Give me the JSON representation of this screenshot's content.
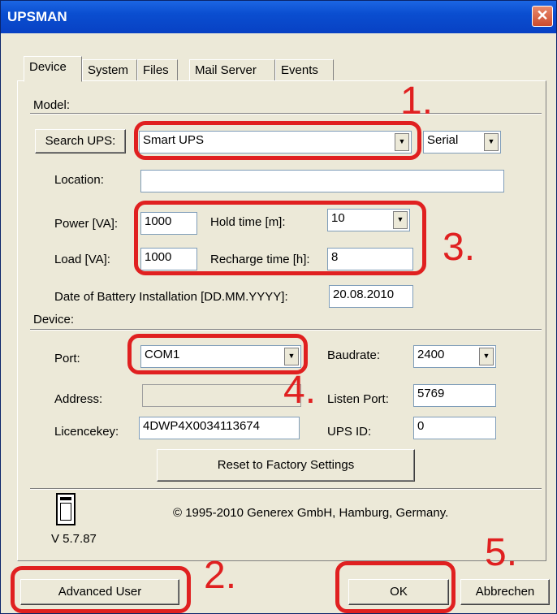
{
  "window": {
    "title": "UPSMAN",
    "close": "✕"
  },
  "tabs": [
    "Device",
    "System",
    "Files",
    "Mail Server",
    "Events"
  ],
  "model": {
    "group_label": "Model:",
    "search_btn": "Search UPS:",
    "ups_type": "Smart UPS",
    "connection": "Serial",
    "location_label": "Location:",
    "location_value": "",
    "power_label": "Power [VA]:",
    "power_value": "1000",
    "hold_label": "Hold time [m]:",
    "hold_value": "10",
    "load_label": "Load [VA]:",
    "load_value": "1000",
    "recharge_label": "Recharge time [h]:",
    "recharge_value": "8",
    "battery_label": "Date of Battery Installation [DD.MM.YYYY]:",
    "battery_value": "20.08.2010"
  },
  "device": {
    "group_label": "Device:",
    "port_label": "Port:",
    "port_value": "COM1",
    "baud_label": "Baudrate:",
    "baud_value": "2400",
    "address_label": "Address:",
    "address_value": "",
    "listen_label": "Listen Port:",
    "listen_value": "5769",
    "licence_label": "Licencekey:",
    "licence_value": "4DWP4X0034113674",
    "upsid_label": "UPS ID:",
    "upsid_value": "0",
    "reset_btn": "Reset to Factory Settings"
  },
  "footer": {
    "copyright": "© 1995-2010 Generex GmbH, Hamburg, Germany.",
    "version": "V 5.7.87",
    "advanced_btn": "Advanced User",
    "ok_btn": "OK",
    "cancel_btn": "Abbrechen"
  },
  "annotations": [
    "1.",
    "2.",
    "3.",
    "4.",
    "5."
  ],
  "colors": {
    "annotation": "#e02020",
    "titlebar": "#0a4ed0",
    "window_bg": "#ece9d8"
  }
}
